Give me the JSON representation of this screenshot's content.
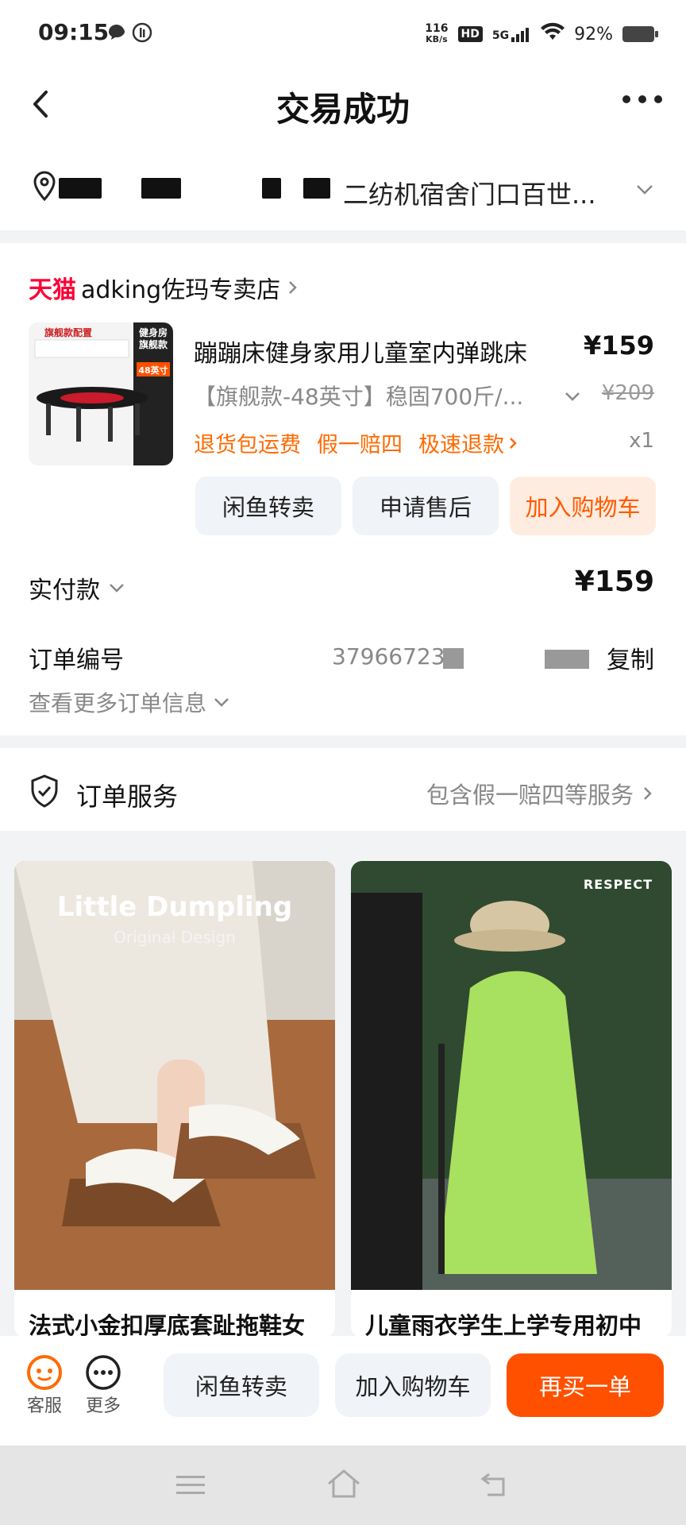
{
  "status_bar": {
    "time": "09:15",
    "net_speed": "116",
    "net_unit": "KB/s",
    "hd": "HD",
    "signal": "5G",
    "battery": "92%"
  },
  "header": {
    "title": "交易成功"
  },
  "address": {
    "text": "二纺机宿舍门口百世..."
  },
  "shop": {
    "badge": "天猫",
    "name": "adking佐玛专卖店",
    "thumb_top_label": "旗舰款配置",
    "thumb_side_label": "健身房旗舰款",
    "thumb_size_label": "48英寸"
  },
  "product": {
    "title": "蹦蹦床健身家用儿童室内弹跳床",
    "price": "¥159",
    "sku": "【旗舰款-48英寸】稳固700斤/...",
    "original_price": "¥209",
    "tags": [
      "退货包运费",
      "假一赔四",
      "极速退款"
    ],
    "quantity": "x1"
  },
  "actions": {
    "resell": "闲鱼转卖",
    "after_sale": "申请售后",
    "add_cart": "加入购物车"
  },
  "payment": {
    "label": "实付款",
    "value": "¥159"
  },
  "order": {
    "number_label": "订单编号",
    "number_value": "37966723",
    "copy": "复制",
    "more_info": "查看更多订单信息"
  },
  "service": {
    "label": "订单服务",
    "info": "包含假一赔四等服务"
  },
  "recommendations": [
    {
      "title": "法式小金扣厚底套趾拖鞋女",
      "brand_text": "Little Dumpling",
      "brand_sub": "Original Design"
    },
    {
      "title": "儿童雨衣学生上学专用初中",
      "brand_text": "RESPECT"
    }
  ],
  "bottom_bar": {
    "service": "客服",
    "more": "更多",
    "resell": "闲鱼转卖",
    "add_cart": "加入购物车",
    "buy_again": "再买一单"
  },
  "colors": {
    "accent": "#ff5000",
    "tmall": "#ff0036",
    "tag_orange": "#ff6a00"
  }
}
